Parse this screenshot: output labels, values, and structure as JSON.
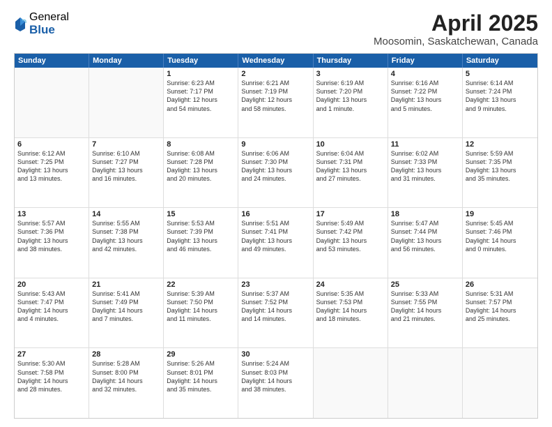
{
  "logo": {
    "general": "General",
    "blue": "Blue"
  },
  "title": "April 2025",
  "subtitle": "Moosomin, Saskatchewan, Canada",
  "header_days": [
    "Sunday",
    "Monday",
    "Tuesday",
    "Wednesday",
    "Thursday",
    "Friday",
    "Saturday"
  ],
  "rows": [
    [
      {
        "day": "",
        "empty": true
      },
      {
        "day": "",
        "empty": true
      },
      {
        "day": "1",
        "line1": "Sunrise: 6:23 AM",
        "line2": "Sunset: 7:17 PM",
        "line3": "Daylight: 12 hours",
        "line4": "and 54 minutes."
      },
      {
        "day": "2",
        "line1": "Sunrise: 6:21 AM",
        "line2": "Sunset: 7:19 PM",
        "line3": "Daylight: 12 hours",
        "line4": "and 58 minutes."
      },
      {
        "day": "3",
        "line1": "Sunrise: 6:19 AM",
        "line2": "Sunset: 7:20 PM",
        "line3": "Daylight: 13 hours",
        "line4": "and 1 minute."
      },
      {
        "day": "4",
        "line1": "Sunrise: 6:16 AM",
        "line2": "Sunset: 7:22 PM",
        "line3": "Daylight: 13 hours",
        "line4": "and 5 minutes."
      },
      {
        "day": "5",
        "line1": "Sunrise: 6:14 AM",
        "line2": "Sunset: 7:24 PM",
        "line3": "Daylight: 13 hours",
        "line4": "and 9 minutes."
      }
    ],
    [
      {
        "day": "6",
        "line1": "Sunrise: 6:12 AM",
        "line2": "Sunset: 7:25 PM",
        "line3": "Daylight: 13 hours",
        "line4": "and 13 minutes."
      },
      {
        "day": "7",
        "line1": "Sunrise: 6:10 AM",
        "line2": "Sunset: 7:27 PM",
        "line3": "Daylight: 13 hours",
        "line4": "and 16 minutes."
      },
      {
        "day": "8",
        "line1": "Sunrise: 6:08 AM",
        "line2": "Sunset: 7:28 PM",
        "line3": "Daylight: 13 hours",
        "line4": "and 20 minutes."
      },
      {
        "day": "9",
        "line1": "Sunrise: 6:06 AM",
        "line2": "Sunset: 7:30 PM",
        "line3": "Daylight: 13 hours",
        "line4": "and 24 minutes."
      },
      {
        "day": "10",
        "line1": "Sunrise: 6:04 AM",
        "line2": "Sunset: 7:31 PM",
        "line3": "Daylight: 13 hours",
        "line4": "and 27 minutes."
      },
      {
        "day": "11",
        "line1": "Sunrise: 6:02 AM",
        "line2": "Sunset: 7:33 PM",
        "line3": "Daylight: 13 hours",
        "line4": "and 31 minutes."
      },
      {
        "day": "12",
        "line1": "Sunrise: 5:59 AM",
        "line2": "Sunset: 7:35 PM",
        "line3": "Daylight: 13 hours",
        "line4": "and 35 minutes."
      }
    ],
    [
      {
        "day": "13",
        "line1": "Sunrise: 5:57 AM",
        "line2": "Sunset: 7:36 PM",
        "line3": "Daylight: 13 hours",
        "line4": "and 38 minutes."
      },
      {
        "day": "14",
        "line1": "Sunrise: 5:55 AM",
        "line2": "Sunset: 7:38 PM",
        "line3": "Daylight: 13 hours",
        "line4": "and 42 minutes."
      },
      {
        "day": "15",
        "line1": "Sunrise: 5:53 AM",
        "line2": "Sunset: 7:39 PM",
        "line3": "Daylight: 13 hours",
        "line4": "and 46 minutes."
      },
      {
        "day": "16",
        "line1": "Sunrise: 5:51 AM",
        "line2": "Sunset: 7:41 PM",
        "line3": "Daylight: 13 hours",
        "line4": "and 49 minutes."
      },
      {
        "day": "17",
        "line1": "Sunrise: 5:49 AM",
        "line2": "Sunset: 7:42 PM",
        "line3": "Daylight: 13 hours",
        "line4": "and 53 minutes."
      },
      {
        "day": "18",
        "line1": "Sunrise: 5:47 AM",
        "line2": "Sunset: 7:44 PM",
        "line3": "Daylight: 13 hours",
        "line4": "and 56 minutes."
      },
      {
        "day": "19",
        "line1": "Sunrise: 5:45 AM",
        "line2": "Sunset: 7:46 PM",
        "line3": "Daylight: 14 hours",
        "line4": "and 0 minutes."
      }
    ],
    [
      {
        "day": "20",
        "line1": "Sunrise: 5:43 AM",
        "line2": "Sunset: 7:47 PM",
        "line3": "Daylight: 14 hours",
        "line4": "and 4 minutes."
      },
      {
        "day": "21",
        "line1": "Sunrise: 5:41 AM",
        "line2": "Sunset: 7:49 PM",
        "line3": "Daylight: 14 hours",
        "line4": "and 7 minutes."
      },
      {
        "day": "22",
        "line1": "Sunrise: 5:39 AM",
        "line2": "Sunset: 7:50 PM",
        "line3": "Daylight: 14 hours",
        "line4": "and 11 minutes."
      },
      {
        "day": "23",
        "line1": "Sunrise: 5:37 AM",
        "line2": "Sunset: 7:52 PM",
        "line3": "Daylight: 14 hours",
        "line4": "and 14 minutes."
      },
      {
        "day": "24",
        "line1": "Sunrise: 5:35 AM",
        "line2": "Sunset: 7:53 PM",
        "line3": "Daylight: 14 hours",
        "line4": "and 18 minutes."
      },
      {
        "day": "25",
        "line1": "Sunrise: 5:33 AM",
        "line2": "Sunset: 7:55 PM",
        "line3": "Daylight: 14 hours",
        "line4": "and 21 minutes."
      },
      {
        "day": "26",
        "line1": "Sunrise: 5:31 AM",
        "line2": "Sunset: 7:57 PM",
        "line3": "Daylight: 14 hours",
        "line4": "and 25 minutes."
      }
    ],
    [
      {
        "day": "27",
        "line1": "Sunrise: 5:30 AM",
        "line2": "Sunset: 7:58 PM",
        "line3": "Daylight: 14 hours",
        "line4": "and 28 minutes."
      },
      {
        "day": "28",
        "line1": "Sunrise: 5:28 AM",
        "line2": "Sunset: 8:00 PM",
        "line3": "Daylight: 14 hours",
        "line4": "and 32 minutes."
      },
      {
        "day": "29",
        "line1": "Sunrise: 5:26 AM",
        "line2": "Sunset: 8:01 PM",
        "line3": "Daylight: 14 hours",
        "line4": "and 35 minutes."
      },
      {
        "day": "30",
        "line1": "Sunrise: 5:24 AM",
        "line2": "Sunset: 8:03 PM",
        "line3": "Daylight: 14 hours",
        "line4": "and 38 minutes."
      },
      {
        "day": "",
        "empty": true
      },
      {
        "day": "",
        "empty": true
      },
      {
        "day": "",
        "empty": true
      }
    ]
  ]
}
